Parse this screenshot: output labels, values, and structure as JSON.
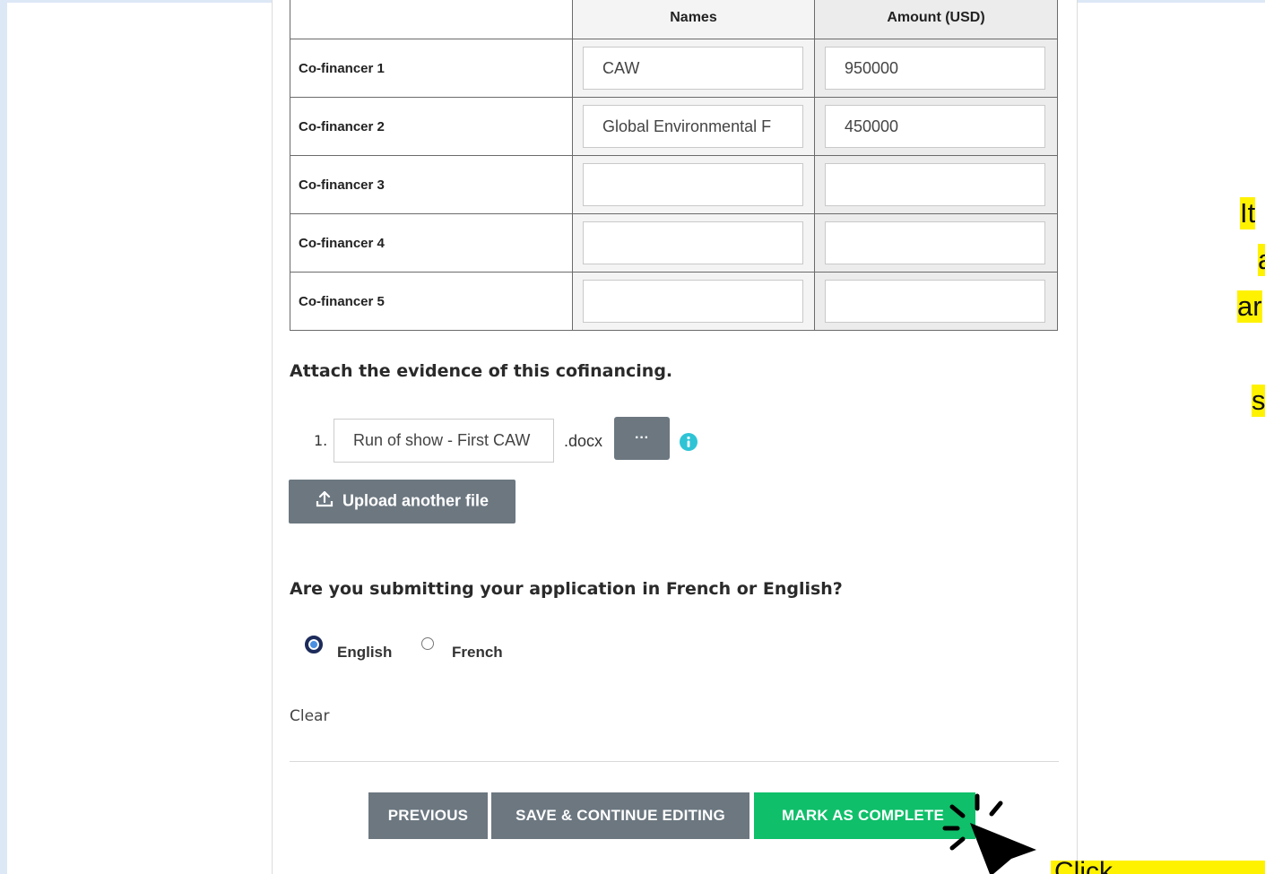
{
  "table": {
    "headers": [
      "",
      "Names",
      "Amount (USD)"
    ],
    "rows": [
      {
        "label": "Co-financer 1",
        "name": "CAW",
        "amount": "950000"
      },
      {
        "label": "Co-financer 2",
        "name": "Global Environmental F",
        "amount": "450000"
      },
      {
        "label": "Co-financer 3",
        "name": "",
        "amount": ""
      },
      {
        "label": "Co-financer 4",
        "name": "",
        "amount": ""
      },
      {
        "label": "Co-financer 5",
        "name": "",
        "amount": ""
      }
    ]
  },
  "attachment": {
    "question": "Attach the evidence of this cofinancing.",
    "files": [
      {
        "index": "1.",
        "name": "Run of show - First CAW",
        "ext": ".docx"
      }
    ],
    "more_label": "···",
    "upload_label": "Upload another file"
  },
  "language": {
    "question": "Are you submitting your application in French or English?",
    "options": [
      {
        "label": "English",
        "selected": true
      },
      {
        "label": "French",
        "selected": false
      }
    ],
    "clear_label": "Clear"
  },
  "buttons": {
    "previous": "PREVIOUS",
    "save": "SAVE & CONTINUE EDITING",
    "complete": "MARK AS COMPLETE"
  },
  "annotation": {
    "side_fragments": [
      "It",
      "a",
      "ar",
      "s"
    ],
    "click_note": "Click"
  },
  "colors": {
    "button_gray": "#6c7780",
    "complete_green": "#0fbf6a",
    "highlight_yellow": "#fff200",
    "page_strip": "#dde8f6"
  }
}
